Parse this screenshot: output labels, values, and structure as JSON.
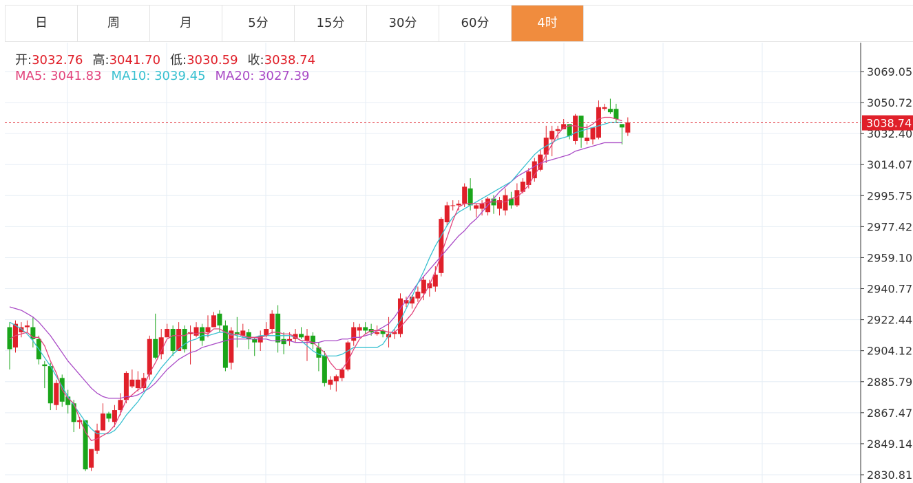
{
  "tabs": [
    {
      "label": "日",
      "active": false
    },
    {
      "label": "周",
      "active": false
    },
    {
      "label": "月",
      "active": false
    },
    {
      "label": "5分",
      "active": false
    },
    {
      "label": "15分",
      "active": false
    },
    {
      "label": "30分",
      "active": false
    },
    {
      "label": "60分",
      "active": false
    },
    {
      "label": "4时",
      "active": true
    }
  ],
  "ohlc": {
    "open_label": "开:",
    "open": "3032.76",
    "high_label": "高:",
    "high": "3041.70",
    "low_label": "低:",
    "low": "3030.59",
    "close_label": "收:",
    "close": "3038.74"
  },
  "ma": {
    "ma5_label": "MA5:",
    "ma5": "3041.83",
    "ma10_label": "MA10:",
    "ma10": "3039.45",
    "ma20_label": "MA20:",
    "ma20": "3027.39"
  },
  "colors": {
    "up": "#e0202a",
    "down": "#1aa51a",
    "ma5": "#e2447c",
    "ma10": "#38c0d0",
    "ma20": "#a94ac6",
    "active_tab": "#f08c3e",
    "grid": "#e6eef5"
  },
  "chart_data": {
    "type": "candlestick",
    "y_ticks": [
      "3069.05",
      "3050.72",
      "3032.40",
      "3014.07",
      "2995.75",
      "2977.42",
      "2959.10",
      "2940.77",
      "2922.44",
      "2904.12",
      "2885.79",
      "2867.47",
      "2849.14",
      "2830.81"
    ],
    "ylim": [
      2830.81,
      3069.05
    ],
    "last_price": "3038.74",
    "candles": [
      [
        2918,
        2905,
        2921,
        2893
      ],
      [
        2906,
        2920,
        2922,
        2903
      ],
      [
        2915,
        2918,
        2921,
        2912
      ],
      [
        2918,
        2919,
        2922,
        2915
      ],
      [
        2918,
        2911,
        2924,
        2906
      ],
      [
        2911,
        2899,
        2913,
        2896
      ],
      [
        2896,
        2895,
        2898,
        2882
      ],
      [
        2895,
        2873,
        2897,
        2869
      ],
      [
        2872,
        2885,
        2887,
        2869
      ],
      [
        2888,
        2874,
        2890,
        2871
      ],
      [
        2877,
        2872,
        2881,
        2867
      ],
      [
        2873,
        2862,
        2875,
        2856
      ],
      [
        2862,
        2863,
        2865,
        2858
      ],
      [
        2863,
        2834,
        2863,
        2833
      ],
      [
        2835,
        2846,
        2846,
        2833
      ],
      [
        2845,
        2857,
        2861,
        2843
      ],
      [
        2857,
        2867,
        2873,
        2857
      ],
      [
        2867,
        2864,
        2868,
        2862
      ],
      [
        2862,
        2869,
        2872,
        2859
      ],
      [
        2869,
        2875,
        2879,
        2866
      ],
      [
        2875,
        2891,
        2892,
        2873
      ],
      [
        2883,
        2887,
        2893,
        2882
      ],
      [
        2882,
        2887,
        2892,
        2880
      ],
      [
        2882,
        2888,
        2891,
        2880
      ],
      [
        2890,
        2911,
        2913,
        2887
      ],
      [
        2911,
        2900,
        2926,
        2899
      ],
      [
        2902,
        2912,
        2917,
        2899
      ],
      [
        2912,
        2917,
        2920,
        2912
      ],
      [
        2917,
        2904,
        2919,
        2901
      ],
      [
        2904,
        2917,
        2921,
        2904
      ],
      [
        2917,
        2905,
        2919,
        2903
      ],
      [
        2914,
        2915,
        2919,
        2896
      ],
      [
        2913,
        2918,
        2921,
        2912
      ],
      [
        2918,
        2910,
        2920,
        2907
      ],
      [
        2915,
        2918,
        2925,
        2912
      ],
      [
        2918,
        2925,
        2927,
        2918
      ],
      [
        2926,
        2919,
        2928,
        2915
      ],
      [
        2919,
        2894,
        2922,
        2892
      ],
      [
        2897,
        2916,
        2918,
        2893
      ],
      [
        2915,
        2914,
        2924,
        2906
      ],
      [
        2913,
        2916,
        2920,
        2912
      ],
      [
        2915,
        2911,
        2917,
        2905
      ],
      [
        2911,
        2909,
        2912,
        2901
      ],
      [
        2909,
        2913,
        2916,
        2904
      ],
      [
        2913,
        2917,
        2921,
        2912
      ],
      [
        2917,
        2926,
        2928,
        2914
      ],
      [
        2926,
        2909,
        2931,
        2903
      ],
      [
        2911,
        2908,
        2915,
        2902
      ],
      [
        2910,
        2911,
        2915,
        2907
      ],
      [
        2911,
        2914,
        2917,
        2909
      ],
      [
        2914,
        2912,
        2918,
        2911
      ],
      [
        2910,
        2913,
        2917,
        2898
      ],
      [
        2913,
        2908,
        2915,
        2905
      ],
      [
        2906,
        2900,
        2909,
        2892
      ],
      [
        2901,
        2885,
        2904,
        2883
      ],
      [
        2884,
        2887,
        2889,
        2881
      ],
      [
        2886,
        2889,
        2890,
        2880
      ],
      [
        2888,
        2893,
        2894,
        2886
      ],
      [
        2893,
        2909,
        2910,
        2892
      ],
      [
        2910,
        2918,
        2921,
        2907
      ],
      [
        2916,
        2918,
        2920,
        2912
      ],
      [
        2918,
        2916,
        2921,
        2914
      ],
      [
        2917,
        2915,
        2920,
        2913
      ],
      [
        2914,
        2915,
        2919,
        2913
      ],
      [
        2916,
        2914,
        2917,
        2912
      ],
      [
        2912,
        2914,
        2924,
        2906
      ],
      [
        2914,
        2915,
        2917,
        2911
      ],
      [
        2914,
        2935,
        2938,
        2912
      ],
      [
        2932,
        2934,
        2936,
        2930
      ],
      [
        2932,
        2936,
        2937,
        2929
      ],
      [
        2935,
        2939,
        2942,
        2933
      ],
      [
        2938,
        2946,
        2948,
        2934
      ],
      [
        2941,
        2944,
        2946,
        2936
      ],
      [
        2942,
        2949,
        2954,
        2939
      ],
      [
        2950,
        2982,
        2983,
        2948
      ],
      [
        2980,
        2990,
        2992,
        2978
      ],
      [
        2990,
        2990,
        2993,
        2987
      ],
      [
        2990,
        2991,
        2993,
        2987
      ],
      [
        2991,
        3001,
        3003,
        2989
      ],
      [
        3000,
        2990,
        3006,
        2987
      ],
      [
        2988,
        2990,
        2991,
        2983
      ],
      [
        2988,
        2991,
        2993,
        2984
      ],
      [
        2986,
        2994,
        2995,
        2984
      ],
      [
        2994,
        2990,
        2996,
        2985
      ],
      [
        2988,
        2993,
        2995,
        2984
      ],
      [
        2987,
        2996,
        3000,
        2984
      ],
      [
        2994,
        2990,
        2998,
        2988
      ],
      [
        2990,
        2999,
        3003,
        2989
      ],
      [
        2998,
        3004,
        3006,
        2997
      ],
      [
        3002,
        3010,
        3012,
        3000
      ],
      [
        3006,
        3016,
        3018,
        3004
      ],
      [
        3011,
        3020,
        3023,
        3010
      ],
      [
        3020,
        3030,
        3037,
        3015
      ],
      [
        3029,
        3034,
        3037,
        3019
      ],
      [
        3034,
        3035,
        3037,
        3029
      ],
      [
        3035,
        3038,
        3041,
        3035
      ],
      [
        3038,
        3031,
        3037,
        3029
      ],
      [
        3028,
        3043,
        3044,
        3026
      ],
      [
        3043,
        3030,
        3043,
        3024
      ],
      [
        3028,
        3030,
        3038,
        3026
      ],
      [
        3029,
        3036,
        3036,
        3026
      ],
      [
        3030,
        3048,
        3052,
        3029
      ],
      [
        3047,
        3048,
        3050,
        3046
      ],
      [
        3047,
        3045,
        3053,
        3044
      ],
      [
        3047,
        3041,
        3050,
        3039
      ],
      [
        3038,
        3036,
        3038,
        3026
      ],
      [
        3033,
        3039,
        3042,
        3031
      ]
    ],
    "ma5": [
      2911,
      2913,
      2914,
      2915,
      2912,
      2912,
      2907,
      2898,
      2891,
      2881,
      2876,
      2873,
      2864,
      2856,
      2851,
      2852,
      2854,
      2856,
      2860,
      2867,
      2875,
      2878,
      2881,
      2883,
      2891,
      2897,
      2904,
      2911,
      2913,
      2913,
      2913,
      2915,
      2914,
      2915,
      2914,
      2917,
      2917,
      2915,
      2913,
      2914,
      2913,
      2912,
      2912,
      2912,
      2913,
      2915,
      2915,
      2914,
      2914,
      2912,
      2910,
      2910,
      2909,
      2906,
      2903,
      2897,
      2893,
      2893,
      2898,
      2905,
      2911,
      2914,
      2916,
      2916,
      2916,
      2915,
      2915,
      2918,
      2922,
      2926,
      2932,
      2937,
      2943,
      2951,
      2961,
      2971,
      2981,
      2989,
      2991,
      2991,
      2991,
      2991,
      2992,
      2992,
      2992,
      2992,
      2994,
      2995,
      2998,
      3002,
      3008,
      3013,
      3020,
      3026,
      3032,
      3036,
      3037,
      3037,
      3036,
      3036,
      3038,
      3041,
      3042,
      3042,
      3041,
      3040
    ],
    "ma10": [
      2921,
      2919,
      2917,
      2914,
      2910,
      2905,
      2900,
      2895,
      2889,
      2883,
      2877,
      2872,
      2867,
      2862,
      2858,
      2855,
      2855,
      2855,
      2857,
      2861,
      2866,
      2870,
      2874,
      2879,
      2884,
      2889,
      2894,
      2898,
      2902,
      2905,
      2908,
      2910,
      2911,
      2913,
      2913,
      2914,
      2915,
      2915,
      2914,
      2913,
      2912,
      2912,
      2912,
      2913,
      2913,
      2913,
      2913,
      2913,
      2913,
      2912,
      2910,
      2907,
      2904,
      2902,
      2901,
      2901,
      2901,
      2902,
      2904,
      2906,
      2906,
      2906,
      2906,
      2906,
      2908,
      2913,
      2917,
      2922,
      2929,
      2936,
      2944,
      2951,
      2959,
      2966,
      2972,
      2978,
      2983,
      2986,
      2988,
      2990,
      2992,
      2994,
      2996,
      2998,
      3000,
      3002,
      3004,
      3008,
      3012,
      3016,
      3020,
      3023,
      3025,
      3027,
      3029,
      3030,
      3031,
      3033,
      3034,
      3035,
      3036,
      3037,
      3038,
      3039,
      3039,
      3039
    ],
    "ma20": [
      2930,
      2929,
      2928,
      2926,
      2924,
      2921,
      2917,
      2913,
      2908,
      2903,
      2898,
      2894,
      2890,
      2886,
      2882,
      2879,
      2877,
      2876,
      2876,
      2876,
      2877,
      2877,
      2878,
      2880,
      2882,
      2885,
      2889,
      2893,
      2896,
      2899,
      2901,
      2903,
      2904,
      2906,
      2907,
      2908,
      2909,
      2910,
      2911,
      2911,
      2911,
      2911,
      2911,
      2911,
      2911,
      2910,
      2910,
      2910,
      2910,
      2909,
      2909,
      2909,
      2909,
      2909,
      2910,
      2910,
      2910,
      2911,
      2911,
      2912,
      2912,
      2913,
      2914,
      2916,
      2918,
      2920,
      2924,
      2929,
      2934,
      2939,
      2944,
      2948,
      2952,
      2956,
      2960,
      2964,
      2968,
      2972,
      2975,
      2979,
      2982,
      2986,
      2990,
      2994,
      2998,
      3001,
      3004,
      3007,
      3009,
      3011,
      3013,
      3015,
      3016,
      3017,
      3018,
      3019,
      3020,
      3022,
      3023,
      3024,
      3025,
      3026,
      3027,
      3027,
      3027,
      3027
    ]
  }
}
